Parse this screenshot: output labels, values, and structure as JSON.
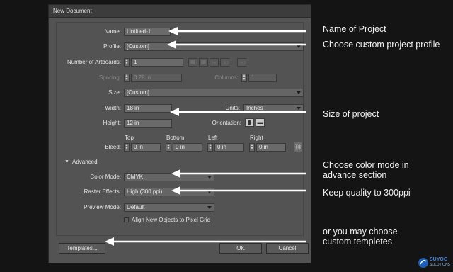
{
  "dialog": {
    "title": "New Document",
    "name_label": "Name:",
    "name_value": "Untitled-1",
    "profile_label": "Profile:",
    "profile_value": "[Custom]",
    "artboards_label": "Number of Artboards:",
    "artboards_value": "1",
    "spacing_label": "Spacing:",
    "spacing_value": "0.28 in",
    "columns_label": "Columns:",
    "columns_value": "1",
    "size_label": "Size:",
    "size_value": "[Custom]",
    "width_label": "Width:",
    "width_value": "18 in",
    "units_label": "Units:",
    "units_value": "Inches",
    "height_label": "Height:",
    "height_value": "12 in",
    "orientation_label": "Orientation:",
    "bleed_label": "Bleed:",
    "bleed_headers": [
      "Top",
      "Bottom",
      "Left",
      "Right"
    ],
    "bleed_values": [
      "0 in",
      "0 in",
      "0 in",
      "0 in"
    ],
    "advanced_label": "Advanced",
    "color_mode_label": "Color Mode:",
    "color_mode_value": "CMYK",
    "raster_label": "Raster Effects:",
    "raster_value": "High (300 ppi)",
    "preview_label": "Preview Mode:",
    "preview_value": "Default",
    "align_label": "Align New Objects to Pixel Grid",
    "templates_button": "Templates...",
    "ok_button": "OK",
    "cancel_button": "Cancel"
  },
  "annotations": {
    "name": "Name of Project",
    "profile": "Choose custom project profile",
    "size": "Size of project",
    "color_mode_1": "Choose color mode in",
    "color_mode_2": "advance section",
    "raster": "Keep quality to 300ppi",
    "templates_1": "or you may choose",
    "templates_2": "custom templetes"
  },
  "watermark": {
    "brand_name": "SUYOG",
    "tagline": "SOLUTIONS"
  },
  "colors": {
    "dialog_bg": "#535353",
    "page_bg": "#141414",
    "annotation": "#ffffff",
    "logo_blue": "#1c5fb4"
  }
}
